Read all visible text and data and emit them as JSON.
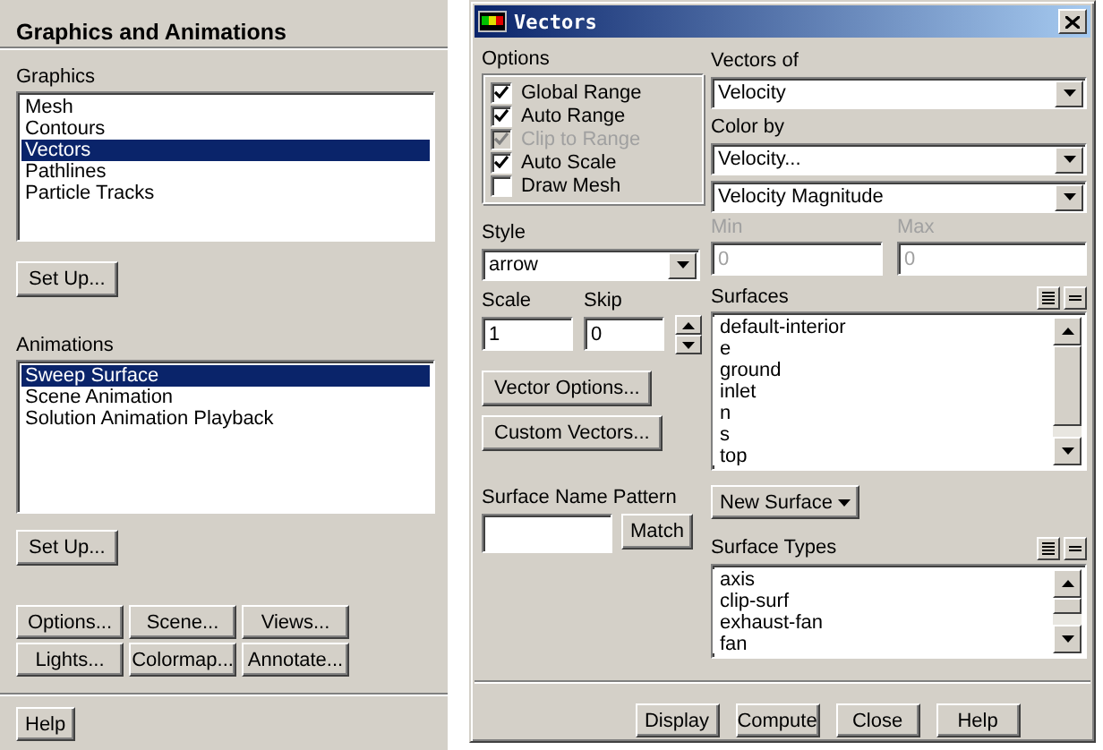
{
  "graphics_panel": {
    "title": "Graphics and Animations",
    "graphics_label": "Graphics",
    "graphics_items": [
      {
        "label": "Mesh",
        "selected": false
      },
      {
        "label": "Contours",
        "selected": false
      },
      {
        "label": "Vectors",
        "selected": true
      },
      {
        "label": "Pathlines",
        "selected": false
      },
      {
        "label": "Particle Tracks",
        "selected": false
      }
    ],
    "graphics_setup": "Set Up...",
    "animations_label": "Animations",
    "animation_items": [
      {
        "label": "Sweep Surface",
        "selected": true
      },
      {
        "label": "Scene Animation",
        "selected": false
      },
      {
        "label": "Solution Animation Playback",
        "selected": false
      }
    ],
    "animations_setup": "Set Up...",
    "buttons": [
      "Options...",
      "Scene...",
      "Views...",
      "Lights...",
      "Colormap...",
      "Annotate..."
    ],
    "help": "Help"
  },
  "vectors_dialog": {
    "title": "Vectors",
    "options_label": "Options",
    "options": [
      {
        "label": "Global Range",
        "checked": true,
        "disabled": false
      },
      {
        "label": "Auto Range",
        "checked": true,
        "disabled": false
      },
      {
        "label": "Clip to Range",
        "checked": true,
        "disabled": true
      },
      {
        "label": "Auto Scale",
        "checked": true,
        "disabled": false
      },
      {
        "label": "Draw Mesh",
        "checked": false,
        "disabled": false
      }
    ],
    "vectors_of_label": "Vectors of",
    "vectors_of": "Velocity",
    "color_by_label": "Color by",
    "color_by": "Velocity...",
    "color_by_detail": "Velocity Magnitude",
    "min": {
      "label": "Min",
      "value": "0",
      "disabled": true
    },
    "max": {
      "label": "Max",
      "value": "0",
      "disabled": true
    },
    "style_label": "Style",
    "style": "arrow",
    "scale_label": "Scale",
    "scale": "1",
    "skip_label": "Skip",
    "skip": "0",
    "vector_options": "Vector Options...",
    "custom_vectors": "Custom Vectors...",
    "surfaces_label": "Surfaces",
    "surfaces": [
      {
        "label": "default-interior",
        "selected": false
      },
      {
        "label": "e",
        "selected": false
      },
      {
        "label": "ground",
        "selected": false
      },
      {
        "label": "inlet",
        "selected": false
      },
      {
        "label": "n",
        "selected": false
      },
      {
        "label": "s",
        "selected": false
      },
      {
        "label": "top",
        "selected": false
      }
    ],
    "pattern_label": "Surface Name Pattern",
    "match": "Match",
    "new_surface": "New Surface",
    "surface_types_label": "Surface Types",
    "surface_types": [
      {
        "label": "axis",
        "selected": false
      },
      {
        "label": "clip-surf",
        "selected": false
      },
      {
        "label": "exhaust-fan",
        "selected": false
      },
      {
        "label": "fan",
        "selected": false
      }
    ],
    "buttons": [
      "Display",
      "Compute",
      "Close",
      "Help"
    ]
  }
}
